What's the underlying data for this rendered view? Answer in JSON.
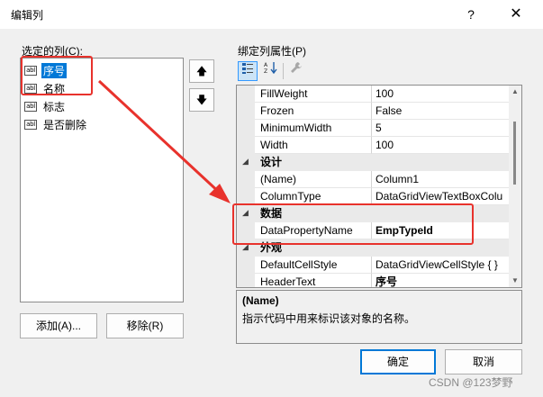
{
  "window": {
    "title": "编辑列",
    "help": "?",
    "close": "✕"
  },
  "left": {
    "columns_label": "选定的列(C):",
    "items": [
      {
        "label": "序号",
        "selected": true
      },
      {
        "label": "名称",
        "selected": false
      },
      {
        "label": "标志",
        "selected": false
      },
      {
        "label": "是否删除",
        "selected": false
      }
    ],
    "item_icon": "abl",
    "up_glyph": "🡅",
    "down_glyph": "🡇",
    "add_label": "添加(A)...",
    "remove_label": "移除(R)"
  },
  "right": {
    "props_label": "绑定列属性(P)",
    "toolbar": {
      "categorized_icon": "categorized-icon",
      "alphabetical_icon": "alphabetical-icon",
      "property_pages_icon": "wrench-icon"
    },
    "rows": [
      {
        "kind": "prop",
        "name": "FillWeight",
        "value": "100"
      },
      {
        "kind": "prop",
        "name": "Frozen",
        "value": "False"
      },
      {
        "kind": "prop",
        "name": "MinimumWidth",
        "value": "5"
      },
      {
        "kind": "prop",
        "name": "Width",
        "value": "100"
      },
      {
        "kind": "cat",
        "name": "设计"
      },
      {
        "kind": "prop",
        "name": "(Name)",
        "value": "Column1"
      },
      {
        "kind": "prop",
        "name": "ColumnType",
        "value": "DataGridViewTextBoxColu"
      },
      {
        "kind": "cat",
        "name": "数据"
      },
      {
        "kind": "prop",
        "name": "DataPropertyName",
        "value": "EmpTypeId",
        "bold": true
      },
      {
        "kind": "cat",
        "name": "外观"
      },
      {
        "kind": "prop",
        "name": "DefaultCellStyle",
        "value": "DataGridViewCellStyle { }"
      },
      {
        "kind": "prop",
        "name": "HeaderText",
        "value": "序号",
        "bold": true
      }
    ],
    "description": {
      "title": "(Name)",
      "text": "指示代码中用来标识该对象的名称。"
    }
  },
  "footer": {
    "ok_label": "确定",
    "cancel_label": "取消"
  },
  "watermark": "CSDN @123梦野",
  "annotation_color": "#e8322c",
  "accent_color": "#0078d7"
}
